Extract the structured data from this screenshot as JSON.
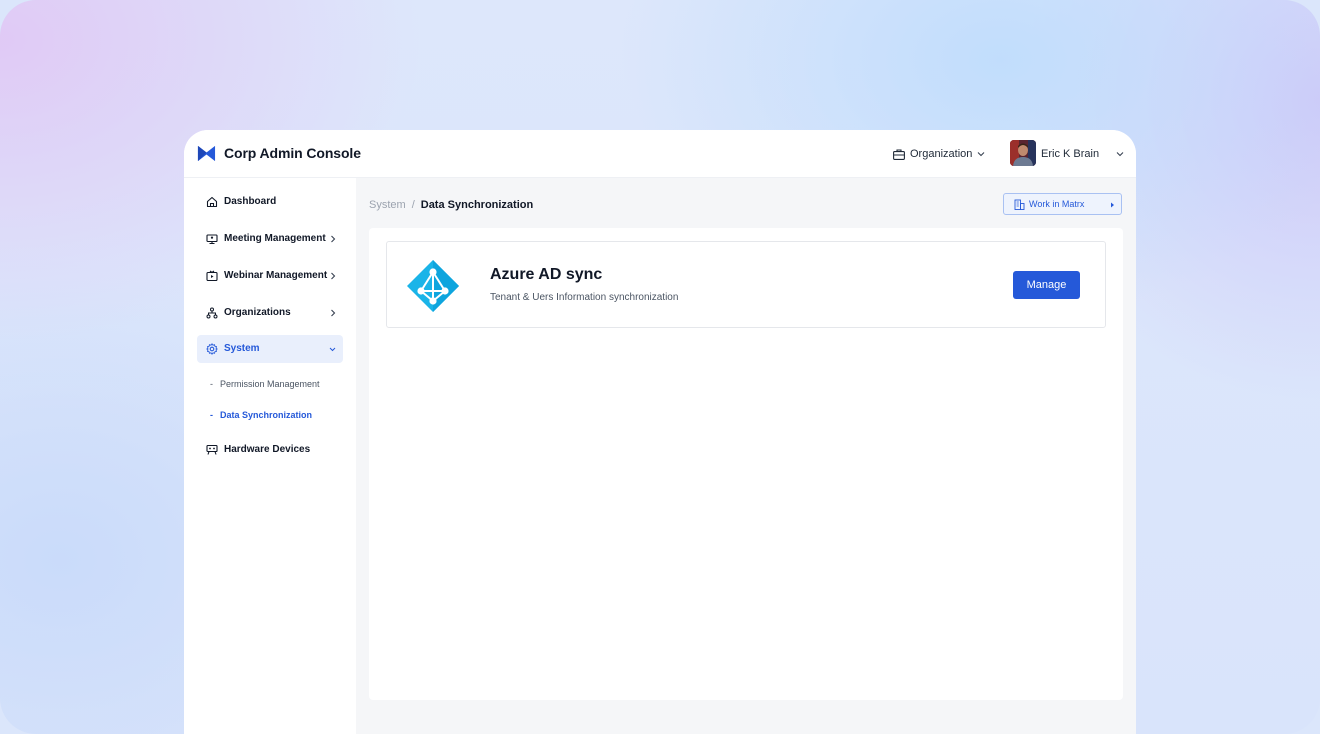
{
  "app": {
    "title": "Corp Admin Console",
    "brand_color": "#2559d9"
  },
  "header": {
    "org_switcher_label": "Organization",
    "user_name": "Eric K Brain"
  },
  "sidebar": {
    "items": [
      {
        "label": "Dashboard",
        "icon": "home-icon",
        "has_chevron": false
      },
      {
        "label": "Meeting Management",
        "icon": "meeting-screen-icon",
        "has_chevron": true
      },
      {
        "label": "Webinar Management",
        "icon": "webinar-icon",
        "has_chevron": true
      },
      {
        "label": "Organizations",
        "icon": "org-tree-icon",
        "has_chevron": true
      },
      {
        "label": "System",
        "icon": "settings-gear-icon",
        "has_chevron": true,
        "expanded": true,
        "active": true
      },
      {
        "label": "Hardware Devices",
        "icon": "hardware-device-icon",
        "has_chevron": false
      }
    ],
    "system_subitems": [
      {
        "label": "Permission Management",
        "active": false
      },
      {
        "label": "Data Synchronization",
        "active": true
      }
    ]
  },
  "breadcrumb": {
    "parent": "System",
    "separator": "/",
    "current": "Data Synchronization"
  },
  "work_button": {
    "label": "Work in Matrx"
  },
  "sync_card": {
    "title": "Azure AD sync",
    "description": "Tenant & Uers Information synchronization",
    "action_label": "Manage",
    "icon": "azure-ad-icon",
    "icon_color": "#1ab4e8"
  }
}
